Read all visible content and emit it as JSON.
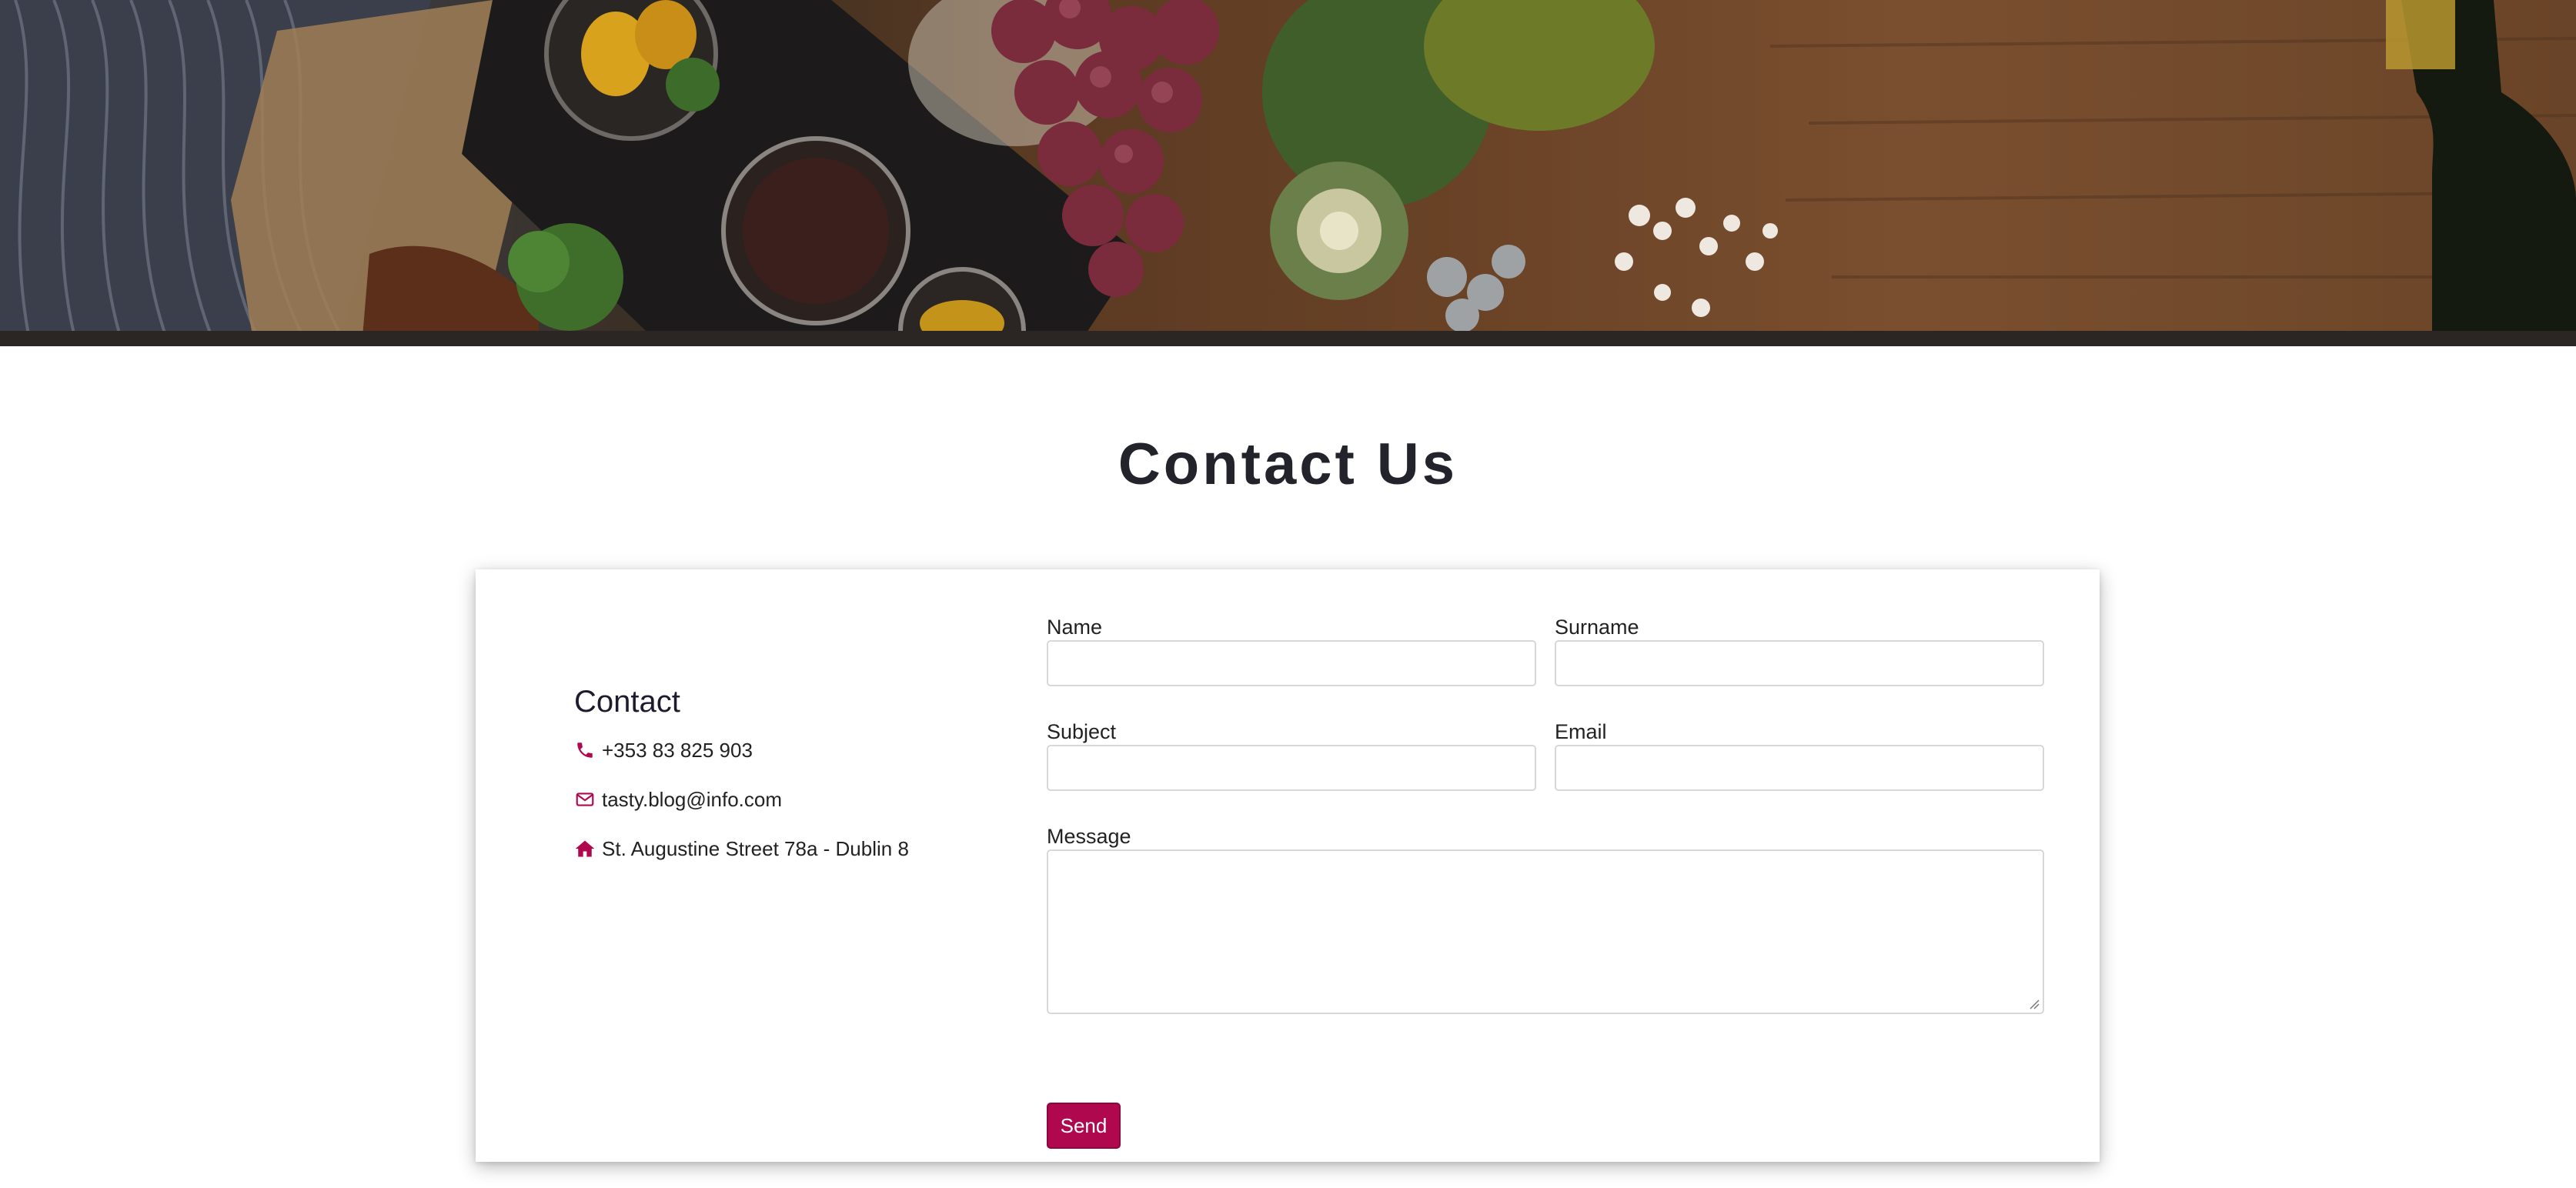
{
  "hero": {
    "icons": [
      "food-photo-banner"
    ]
  },
  "page": {
    "title": "Contact Us"
  },
  "contact": {
    "heading": "Contact",
    "phone": "+353 83 825 903",
    "email": "tasty.blog@info.com",
    "address": "St. Augustine Street 78a - Dublin 8",
    "icons": [
      "phone-icon",
      "envelope-icon",
      "home-icon"
    ],
    "accent_color": "#b0084e"
  },
  "form": {
    "name_label": "Name",
    "surname_label": "Surname",
    "subject_label": "Subject",
    "email_label": "Email",
    "message_label": "Message",
    "name_value": "",
    "surname_value": "",
    "subject_value": "",
    "email_value": "",
    "message_value": "",
    "send_label": "Send",
    "button_color": "#b0084e"
  }
}
